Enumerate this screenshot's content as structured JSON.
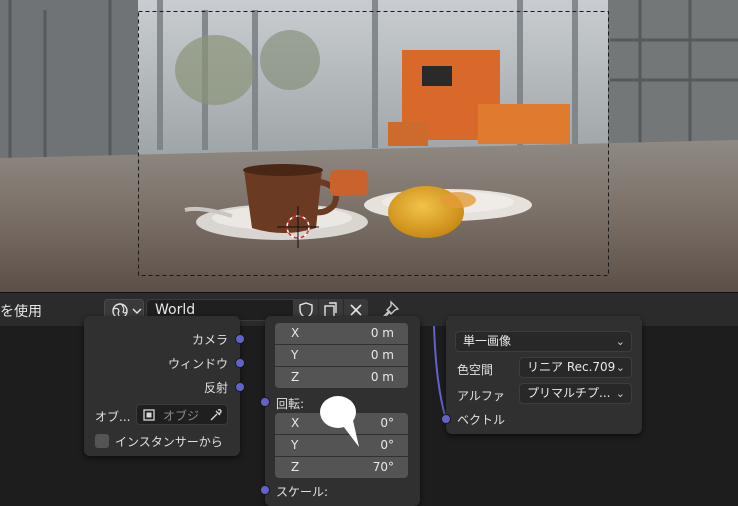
{
  "header": {
    "left_label": "を使用",
    "world_name": "World"
  },
  "texture_node": {
    "outputs": [
      "カメラ",
      "ウィンドウ",
      "反射"
    ],
    "object_label": "オブ...",
    "object_placeholder": "オブジ",
    "instancer_label": "インスタンサーから"
  },
  "mapping_node": {
    "location": [
      {
        "axis": "X",
        "value": "0 m"
      },
      {
        "axis": "Y",
        "value": "0 m"
      },
      {
        "axis": "Z",
        "value": "0 m"
      }
    ],
    "rotation_label": "回転:",
    "rotation": [
      {
        "axis": "X",
        "value": "0°"
      },
      {
        "axis": "Y",
        "value": "0°"
      },
      {
        "axis": "Z",
        "value": "70°"
      }
    ],
    "scale_label": "スケール:"
  },
  "image_node": {
    "projection": "単一画像",
    "colorspace_label": "色空間",
    "colorspace_value": "リニア Rec.709",
    "alpha_label": "アルファ",
    "alpha_value": "プリマルチプ...",
    "vector_label": "ベクトル"
  },
  "colors": {
    "socket_vector": "#6363c7",
    "node_bg": "#303030",
    "header_bg": "#2b2b2b"
  }
}
